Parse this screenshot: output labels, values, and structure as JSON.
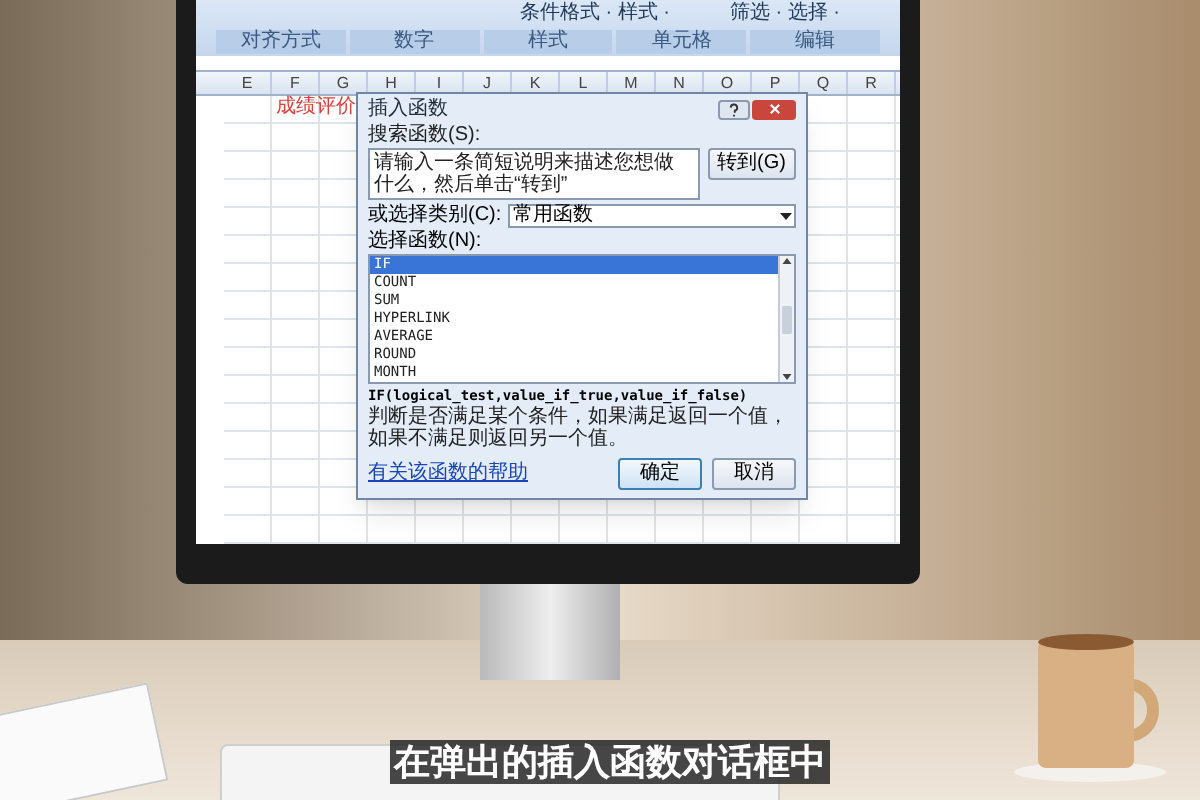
{
  "ribbon": {
    "top_items": [
      "条件格式 · 样式 ·",
      "筛选 · 选择 ·"
    ],
    "groups": [
      "对齐方式",
      "数字",
      "样式",
      "单元格",
      "编辑"
    ]
  },
  "sheet": {
    "columns": [
      "E",
      "F",
      "G",
      "H",
      "I",
      "J",
      "K",
      "L",
      "M",
      "N",
      "O",
      "P",
      "Q",
      "R"
    ],
    "cells": [
      {
        "text": "成绩评价",
        "color": "#e0403a"
      }
    ]
  },
  "dialog": {
    "title": "插入函数",
    "search_label": "搜索函数(S):",
    "search_value": "请输入一条简短说明来描述您想做什么，然后单击“转到”",
    "go_button": "转到(G)",
    "category_label": "或选择类别(C):",
    "category_value": "常用函数",
    "function_label": "选择函数(N):",
    "functions": [
      {
        "name": "IF",
        "selected": true
      },
      {
        "name": "COUNT",
        "selected": false
      },
      {
        "name": "SUM",
        "selected": false
      },
      {
        "name": "HYPERLINK",
        "selected": false
      },
      {
        "name": "AVERAGE",
        "selected": false
      },
      {
        "name": "ROUND",
        "selected": false
      },
      {
        "name": "MONTH",
        "selected": false
      }
    ],
    "syntax": "IF(logical_test,value_if_true,value_if_false)",
    "description": "判断是否满足某个条件，如果满足返回一个值，如果不满足则返回另一个值。",
    "help_link": "有关该函数的帮助",
    "ok_button": "确定",
    "cancel_button": "取消"
  },
  "subtitle": "在弹出的插入函数对话框中"
}
